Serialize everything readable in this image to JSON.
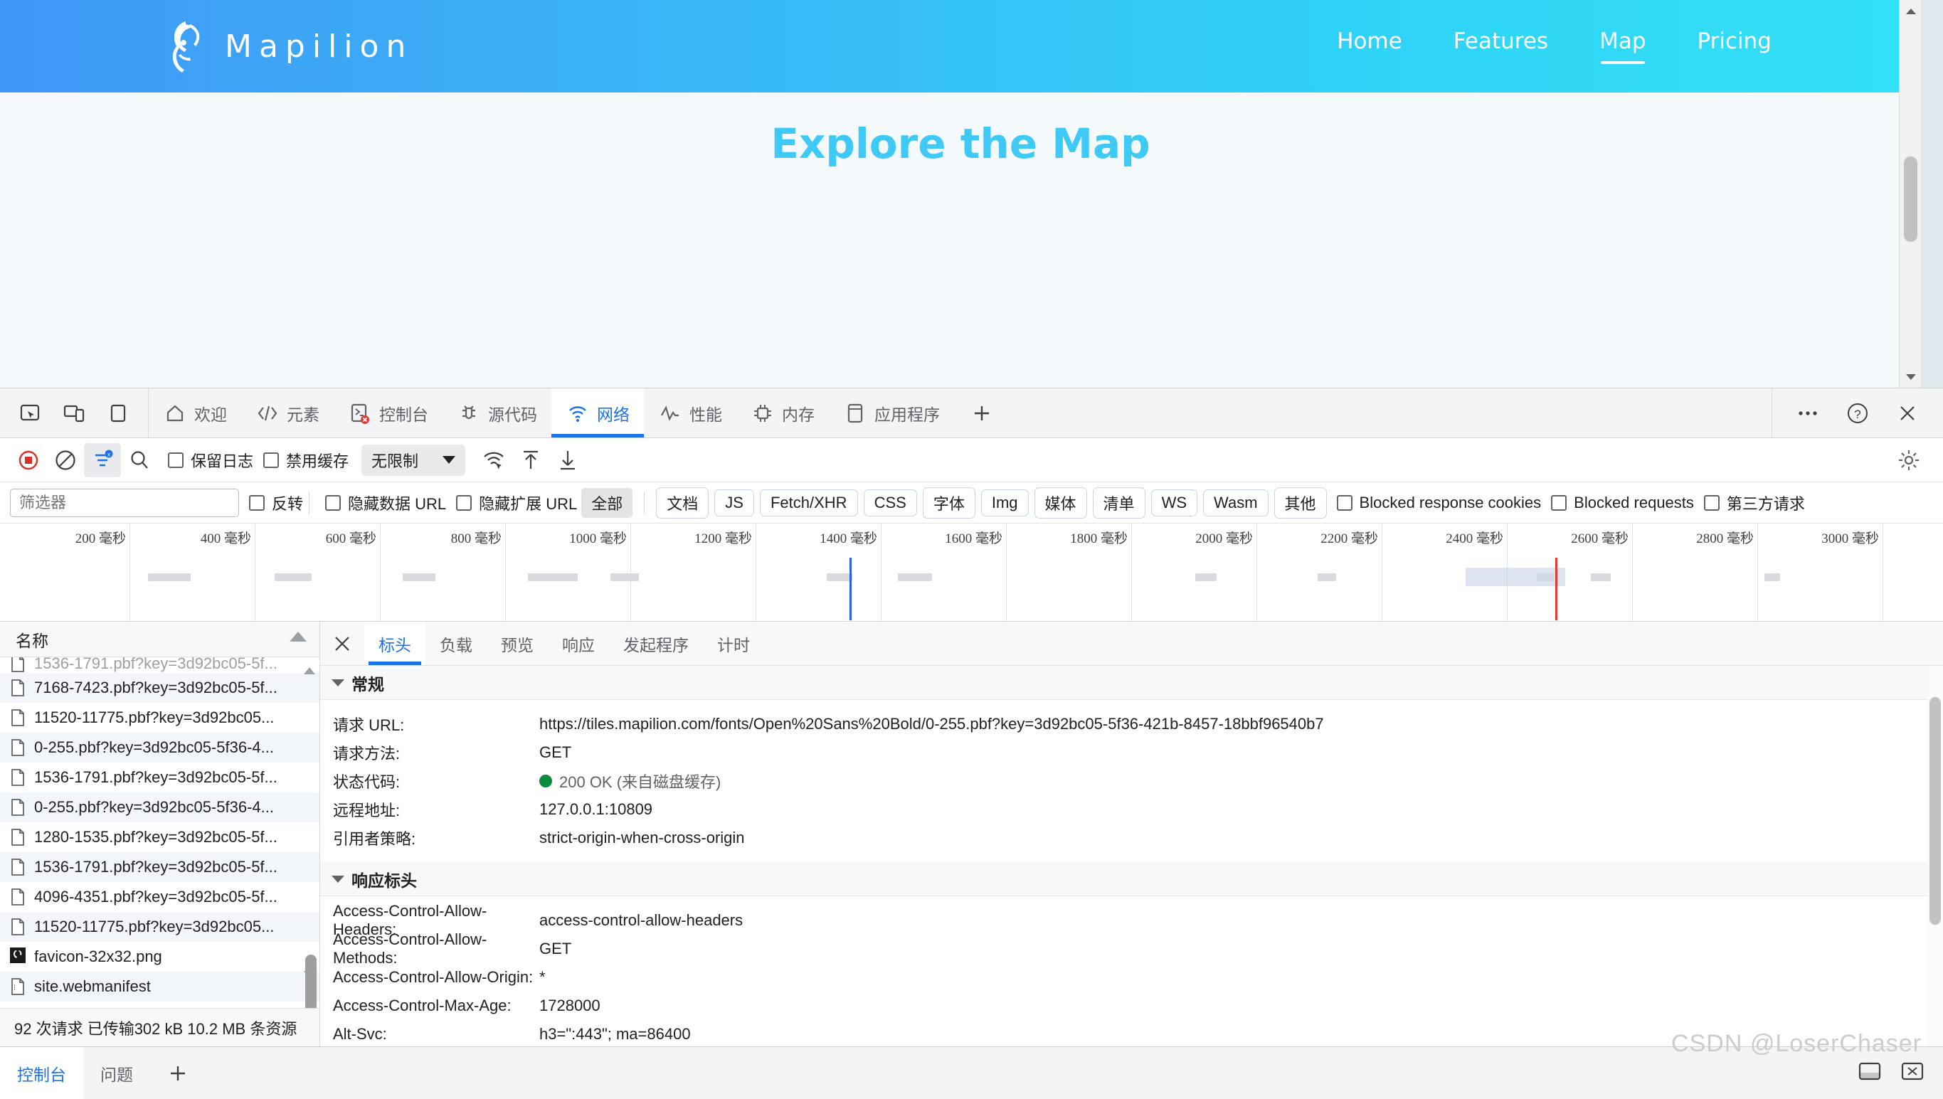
{
  "site": {
    "brand": "Mapilion",
    "brand_logo_icon": "lion-head-logo",
    "nav": [
      {
        "label": "Home",
        "active": false
      },
      {
        "label": "Features",
        "active": false
      },
      {
        "label": "Map",
        "active": true
      },
      {
        "label": "Pricing",
        "active": false
      }
    ],
    "page_title": "Explore the Map",
    "map_controls": {
      "zoom_in": "+",
      "zoom_out": "−",
      "compass_icon": "compass-tilt-icon",
      "scroll_top_icon": "chevron-up-icon"
    },
    "accent_color": "#3ec9f7",
    "header_gradient_from": "#3f97f6",
    "header_gradient_to": "#33e1f5"
  },
  "devtools": {
    "tabs": [
      {
        "label": "欢迎",
        "icon": "home-icon",
        "active": false
      },
      {
        "label": "元素",
        "icon": "code-brackets-icon",
        "active": false
      },
      {
        "label": "控制台",
        "icon": "console-terminal-icon",
        "active": false,
        "error_badge": true
      },
      {
        "label": "源代码",
        "icon": "sources-bug-icon",
        "active": false
      },
      {
        "label": "网络",
        "icon": "network-wifi-icon",
        "active": true
      },
      {
        "label": "性能",
        "icon": "performance-pulse-icon",
        "active": false
      },
      {
        "label": "内存",
        "icon": "memory-chip-icon",
        "active": false
      },
      {
        "label": "应用程序",
        "icon": "application-window-icon",
        "active": false
      }
    ],
    "tab_add_icon": "plus-icon",
    "left_icons": [
      "inspect-element-icon",
      "device-toolbar-icon",
      "dock-side-icon"
    ],
    "right_icons": [
      "more-options-icon",
      "help-icon",
      "close-icon"
    ],
    "toolbar": {
      "record_icon": "record-stop-icon",
      "clear_icon": "clear-no-entry-icon",
      "filter_icon": "filter-funnel-icon",
      "search_icon": "search-icon",
      "preserve_log_label": "保留日志",
      "preserve_log_checked": false,
      "disable_cache_label": "禁用缓存",
      "disable_cache_checked": false,
      "throttle_value": "无限制",
      "throttle_caret_icon": "chevron-down-icon",
      "network_conditions_icon": "network-conditions-icon",
      "import_har_icon": "upload-arrow-icon",
      "export_har_icon": "download-arrow-icon",
      "settings_icon": "gear-icon"
    },
    "filterbar": {
      "filter_placeholder": "筛选器",
      "filter_value": "",
      "invert_label": "反转",
      "invert_checked": false,
      "hide_data_urls_label": "隐藏数据 URL",
      "hide_data_urls_checked": false,
      "hide_ext_urls_label": "隐藏扩展 URL",
      "hide_ext_urls_checked": false,
      "types": [
        {
          "label": "全部",
          "active": true
        },
        {
          "label": "文档",
          "active": false
        },
        {
          "label": "JS",
          "active": false
        },
        {
          "label": "Fetch/XHR",
          "active": false
        },
        {
          "label": "CSS",
          "active": false
        },
        {
          "label": "字体",
          "active": false
        },
        {
          "label": "Img",
          "active": false
        },
        {
          "label": "媒体",
          "active": false
        },
        {
          "label": "清单",
          "active": false
        },
        {
          "label": "WS",
          "active": false
        },
        {
          "label": "Wasm",
          "active": false
        },
        {
          "label": "其他",
          "active": false
        }
      ],
      "blocked_cookies_label": "Blocked response cookies",
      "blocked_cookies_checked": false,
      "blocked_requests_label": "Blocked requests",
      "blocked_requests_checked": false,
      "third_party_label": "第三方请求",
      "third_party_checked": false
    },
    "overview": {
      "ticks": [
        "200 毫秒",
        "400 毫秒",
        "600 毫秒",
        "800 毫秒",
        "1000 毫秒",
        "1200 毫秒",
        "1400 毫秒",
        "1600 毫秒",
        "1800 毫秒",
        "2000 毫秒",
        "2200 毫秒",
        "2400 毫秒",
        "2600 毫秒",
        "2800 毫秒",
        "3000 毫秒"
      ],
      "dom_content_loaded_ms": 1390,
      "load_ms": 2560
    },
    "request_list": {
      "column_header": "名称",
      "sort_icon": "sort-ascending-icon",
      "rows": [
        {
          "name": "1536-1791.pbf?key=3d92bc05-5f...",
          "icon": "file-icon",
          "clipped": true
        },
        {
          "name": "7168-7423.pbf?key=3d92bc05-5f...",
          "icon": "file-icon"
        },
        {
          "name": "11520-11775.pbf?key=3d92bc05...",
          "icon": "file-icon"
        },
        {
          "name": "0-255.pbf?key=3d92bc05-5f36-4...",
          "icon": "file-icon"
        },
        {
          "name": "1536-1791.pbf?key=3d92bc05-5f...",
          "icon": "file-icon"
        },
        {
          "name": "0-255.pbf?key=3d92bc05-5f36-4...",
          "icon": "file-icon"
        },
        {
          "name": "1280-1535.pbf?key=3d92bc05-5f...",
          "icon": "file-icon"
        },
        {
          "name": "1536-1791.pbf?key=3d92bc05-5f...",
          "icon": "file-icon"
        },
        {
          "name": "4096-4351.pbf?key=3d92bc05-5f...",
          "icon": "file-icon"
        },
        {
          "name": "11520-11775.pbf?key=3d92bc05...",
          "icon": "file-icon"
        },
        {
          "name": "favicon-32x32.png",
          "icon": "image-thumbnail-icon"
        },
        {
          "name": "site.webmanifest",
          "icon": "manifest-file-icon"
        }
      ],
      "summary": "92 次请求  已传输302 kB  10.2 MB 条资源"
    },
    "details": {
      "close_icon": "close-icon",
      "tabs": [
        {
          "label": "标头",
          "active": true
        },
        {
          "label": "负载",
          "active": false
        },
        {
          "label": "预览",
          "active": false
        },
        {
          "label": "响应",
          "active": false
        },
        {
          "label": "发起程序",
          "active": false
        },
        {
          "label": "计时",
          "active": false
        }
      ],
      "general": {
        "title": "常规",
        "rows": [
          {
            "key": "请求 URL:",
            "value": "https://tiles.mapilion.com/fonts/Open%20Sans%20Bold/0-255.pbf?key=3d92bc05-5f36-421b-8457-18bbf96540b7"
          },
          {
            "key": "请求方法:",
            "value": "GET"
          },
          {
            "key": "状态代码:",
            "value": "200 OK (来自磁盘缓存)",
            "status_dot": "#0a8a3c",
            "muted": true
          },
          {
            "key": "远程地址:",
            "value": "127.0.0.1:10809"
          },
          {
            "key": "引用者策略:",
            "value": "strict-origin-when-cross-origin"
          }
        ]
      },
      "response_headers": {
        "title": "响应标头",
        "rows": [
          {
            "key": "Access-Control-Allow-Headers:",
            "value": "access-control-allow-headers"
          },
          {
            "key": "Access-Control-Allow-Methods:",
            "value": "GET"
          },
          {
            "key": "Access-Control-Allow-Origin:",
            "value": "*"
          },
          {
            "key": "Access-Control-Max-Age:",
            "value": "1728000"
          },
          {
            "key": "Alt-Svc:",
            "value": "h3=\":443\"; ma=86400"
          }
        ]
      }
    },
    "drawer": {
      "tabs": [
        {
          "label": "控制台",
          "active": true
        },
        {
          "label": "问题",
          "active": false
        }
      ],
      "add_icon": "plus-icon",
      "right_icons": [
        "dock-bottom-icon",
        "close-drawer-icon"
      ]
    }
  },
  "watermark": "CSDN @LoserChaser"
}
